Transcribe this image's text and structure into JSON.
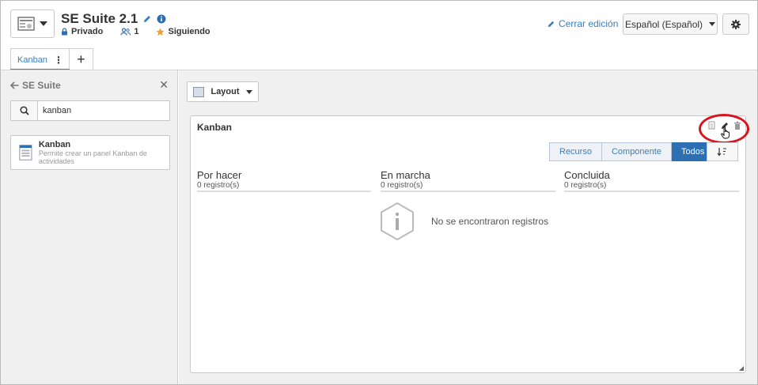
{
  "header": {
    "title": "SE Suite 2.1",
    "privacy": "Privado",
    "members": "1",
    "following": "Siguiendo",
    "close_edit": "Cerrar edición",
    "language": "Español (Español)"
  },
  "tabs": [
    {
      "label": "Kanban",
      "active": true
    }
  ],
  "sidebar": {
    "back_label": "SE Suite",
    "search": {
      "value": "kanban",
      "placeholder": ""
    },
    "widgets": [
      {
        "name": "Kanban",
        "description": "Permite crear un panel Kanban de actividades"
      }
    ]
  },
  "main": {
    "layout_label": "Layout",
    "panel": {
      "title": "Kanban",
      "filters": [
        {
          "label": "Recurso",
          "active": false
        },
        {
          "label": "Componente",
          "active": false
        },
        {
          "label": "Todos",
          "active": true
        }
      ],
      "columns": [
        {
          "title": "Por hacer",
          "count": "0 registro(s)"
        },
        {
          "title": "En marcha",
          "count": "0 registro(s)"
        },
        {
          "title": "Concluida",
          "count": "0 registro(s)"
        }
      ],
      "empty_message": "No se encontraron registros"
    }
  },
  "colors": {
    "accent": "#3a7ebf",
    "active_filter": "#2d6fb3",
    "highlight_ring": "#d9141e"
  }
}
